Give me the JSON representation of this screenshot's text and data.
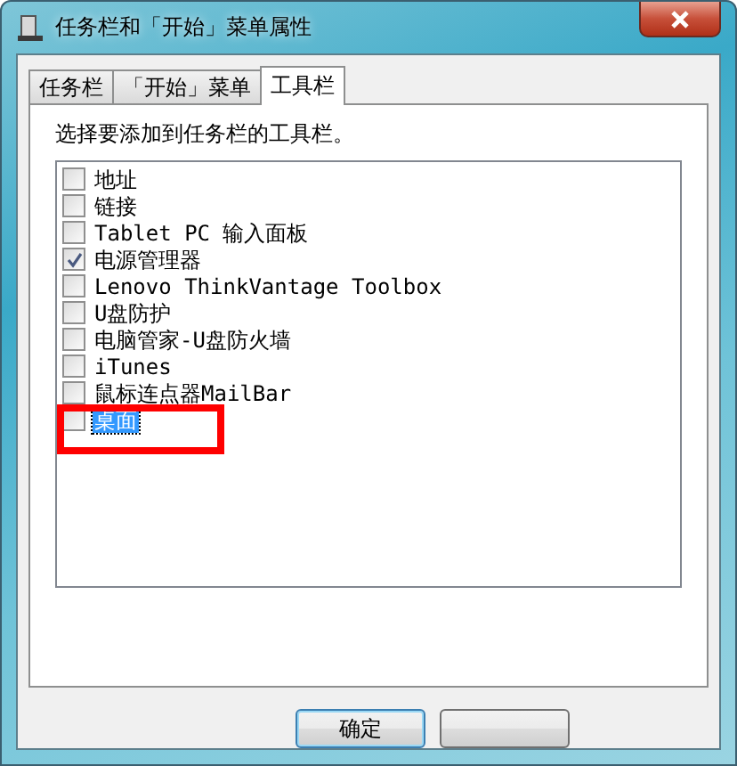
{
  "window": {
    "title": "任务栏和「开始」菜单属性"
  },
  "tabs": [
    {
      "label": "任务栏",
      "selected": false
    },
    {
      "label": "「开始」菜单",
      "selected": false
    },
    {
      "label": "工具栏",
      "selected": true
    }
  ],
  "prompt": "选择要添加到任务栏的工具栏。",
  "toolbars": [
    {
      "label": "地址",
      "checked": false,
      "selected": false
    },
    {
      "label": "链接",
      "checked": false,
      "selected": false
    },
    {
      "label": "Tablet PC 输入面板",
      "checked": false,
      "selected": false
    },
    {
      "label": "电源管理器",
      "checked": true,
      "selected": false
    },
    {
      "label": "Lenovo ThinkVantage Toolbox",
      "checked": false,
      "selected": false
    },
    {
      "label": "U盘防护",
      "checked": false,
      "selected": false
    },
    {
      "label": "电脑管家-U盘防火墙",
      "checked": false,
      "selected": false
    },
    {
      "label": "iTunes",
      "checked": false,
      "selected": false
    },
    {
      "label": "鼠标连点器MailBar",
      "checked": false,
      "selected": false
    },
    {
      "label": "桌面",
      "checked": false,
      "selected": true
    }
  ],
  "buttons": [
    {
      "label": "确定",
      "kind": "default"
    },
    {
      "kind": "plain"
    }
  ]
}
